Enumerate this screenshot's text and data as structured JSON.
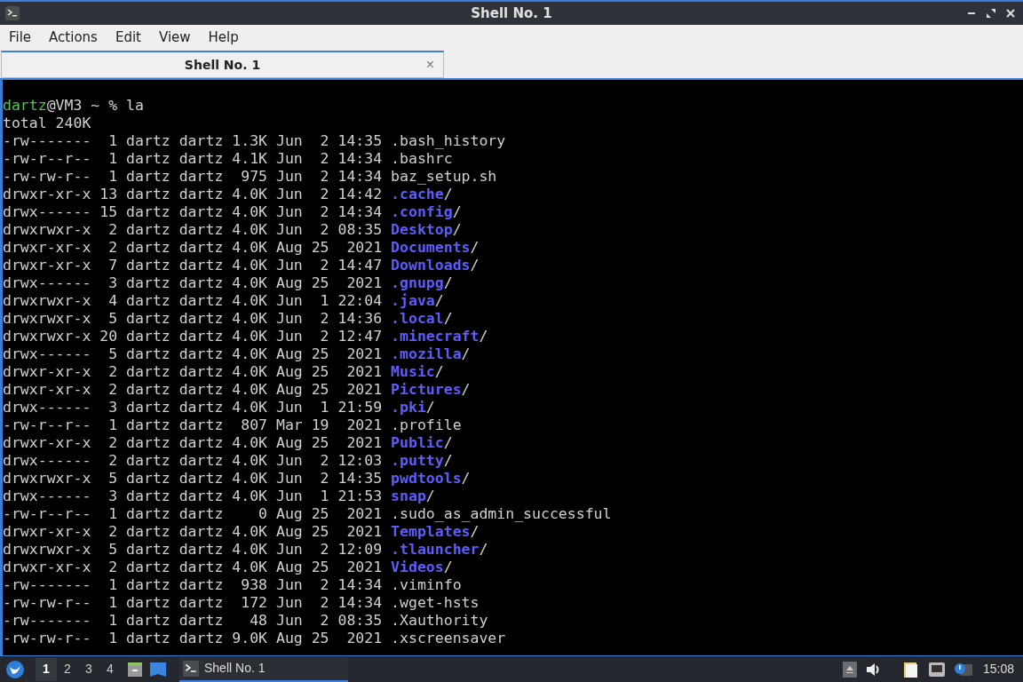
{
  "window": {
    "title": "Shell No. 1"
  },
  "menu": [
    "File",
    "Actions",
    "Edit",
    "View",
    "Help"
  ],
  "tabs": [
    {
      "label": "Shell No. 1",
      "selected": true,
      "close": "×"
    }
  ],
  "terminal": {
    "prompt": {
      "user": "dartz",
      "rest": "@VM3 ~ % la"
    },
    "total": "total 240K",
    "lines": [
      {
        "kind": "file",
        "meta": "-rw-------  1 dartz dartz 1.3K Jun  2 14:35",
        "name": ".bash_history"
      },
      {
        "kind": "file",
        "meta": "-rw-r--r--  1 dartz dartz 4.1K Jun  2 14:34",
        "name": ".bashrc"
      },
      {
        "kind": "file",
        "meta": "-rw-rw-r--  1 dartz dartz  975 Jun  2 14:34",
        "name": "baz_setup.sh"
      },
      {
        "kind": "dir",
        "meta": "drwxr-xr-x 13 dartz dartz 4.0K Jun  2 14:42",
        "name": ".cache",
        "suffix": "/"
      },
      {
        "kind": "dir",
        "meta": "drwx------ 15 dartz dartz 4.0K Jun  2 14:34",
        "name": ".config",
        "suffix": "/"
      },
      {
        "kind": "dir",
        "meta": "drwxrwxr-x  2 dartz dartz 4.0K Jun  2 08:35",
        "name": "Desktop",
        "suffix": "/"
      },
      {
        "kind": "dir",
        "meta": "drwxr-xr-x  2 dartz dartz 4.0K Aug 25  2021",
        "name": "Documents",
        "suffix": "/"
      },
      {
        "kind": "dir",
        "meta": "drwxr-xr-x  7 dartz dartz 4.0K Jun  2 14:47",
        "name": "Downloads",
        "suffix": "/"
      },
      {
        "kind": "dir",
        "meta": "drwx------  3 dartz dartz 4.0K Aug 25  2021",
        "name": ".gnupg",
        "suffix": "/"
      },
      {
        "kind": "dir",
        "meta": "drwxrwxr-x  4 dartz dartz 4.0K Jun  1 22:04",
        "name": ".java",
        "suffix": "/"
      },
      {
        "kind": "dir",
        "meta": "drwxrwxr-x  5 dartz dartz 4.0K Jun  2 14:36",
        "name": ".local",
        "suffix": "/"
      },
      {
        "kind": "dir",
        "meta": "drwxrwxr-x 20 dartz dartz 4.0K Jun  2 12:47",
        "name": ".minecraft",
        "suffix": "/"
      },
      {
        "kind": "dir",
        "meta": "drwx------  5 dartz dartz 4.0K Aug 25  2021",
        "name": ".mozilla",
        "suffix": "/"
      },
      {
        "kind": "dir",
        "meta": "drwxr-xr-x  2 dartz dartz 4.0K Aug 25  2021",
        "name": "Music",
        "suffix": "/"
      },
      {
        "kind": "dir",
        "meta": "drwxr-xr-x  2 dartz dartz 4.0K Aug 25  2021",
        "name": "Pictures",
        "suffix": "/"
      },
      {
        "kind": "dir",
        "meta": "drwx------  3 dartz dartz 4.0K Jun  1 21:59",
        "name": ".pki",
        "suffix": "/"
      },
      {
        "kind": "file",
        "meta": "-rw-r--r--  1 dartz dartz  807 Mar 19  2021",
        "name": ".profile"
      },
      {
        "kind": "dir",
        "meta": "drwxr-xr-x  2 dartz dartz 4.0K Aug 25  2021",
        "name": "Public",
        "suffix": "/"
      },
      {
        "kind": "dir",
        "meta": "drwx------  2 dartz dartz 4.0K Jun  2 12:03",
        "name": ".putty",
        "suffix": "/"
      },
      {
        "kind": "dir",
        "meta": "drwxrwxr-x  5 dartz dartz 4.0K Jun  2 14:35",
        "name": "pwdtools",
        "suffix": "/"
      },
      {
        "kind": "dir",
        "meta": "drwx------  3 dartz dartz 4.0K Jun  1 21:53",
        "name": "snap",
        "suffix": "/"
      },
      {
        "kind": "file",
        "meta": "-rw-r--r--  1 dartz dartz    0 Aug 25  2021",
        "name": ".sudo_as_admin_successful"
      },
      {
        "kind": "dir",
        "meta": "drwxr-xr-x  2 dartz dartz 4.0K Aug 25  2021",
        "name": "Templates",
        "suffix": "/"
      },
      {
        "kind": "dir",
        "meta": "drwxrwxr-x  5 dartz dartz 4.0K Jun  2 12:09",
        "name": ".tlauncher",
        "suffix": "/"
      },
      {
        "kind": "dir",
        "meta": "drwxr-xr-x  2 dartz dartz 4.0K Aug 25  2021",
        "name": "Videos",
        "suffix": "/"
      },
      {
        "kind": "file",
        "meta": "-rw-------  1 dartz dartz  938 Jun  2 14:34",
        "name": ".viminfo"
      },
      {
        "kind": "file",
        "meta": "-rw-rw-r--  1 dartz dartz  172 Jun  2 14:34",
        "name": ".wget-hsts"
      },
      {
        "kind": "file",
        "meta": "-rw-------  1 dartz dartz   48 Jun  2 08:35",
        "name": ".Xauthority"
      },
      {
        "kind": "file",
        "meta": "-rw-rw-r--  1 dartz dartz 9.0K Aug 25  2021",
        "name": ".xscreensaver"
      }
    ]
  },
  "taskbar": {
    "workspaces": [
      {
        "label": "1",
        "selected": true
      },
      {
        "label": "2",
        "selected": false
      },
      {
        "label": "3",
        "selected": false
      },
      {
        "label": "4",
        "selected": false
      }
    ],
    "task": {
      "label": "Shell No. 1",
      "selected": true
    },
    "clock": "15:08"
  }
}
